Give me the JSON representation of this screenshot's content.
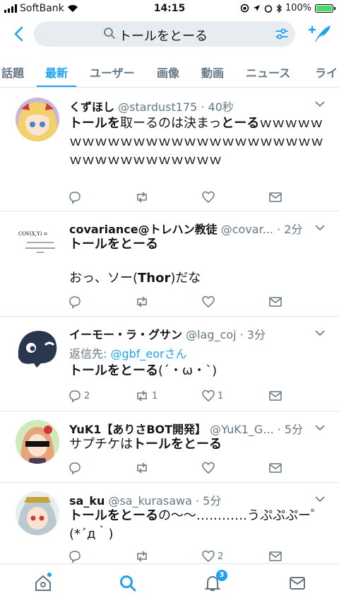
{
  "status": {
    "carrier": "SoftBank",
    "time": "14:15",
    "battery": "100%"
  },
  "search": {
    "query": "トールをとーる"
  },
  "tabs": [
    "話題",
    "最新",
    "ユーザー",
    "画像",
    "動画",
    "ニュース",
    "ライ"
  ],
  "tweets": [
    {
      "name": "くずほし",
      "meta": "@stardust175 · 40秒",
      "body_bold1": "トールを",
      "body_plain1": "取ーるのは決まっ",
      "body_bold2": "とーる",
      "body_plain2": "ｗｗｗｗｗｗｗｗｗｗｗｗｗｗｗｗｗｗｗｗｗｗｗｗｗｗｗｗｗｗｗｗｗｗｗｗｗ",
      "reply": "",
      "retweet": "",
      "like": ""
    },
    {
      "name": "covariance@トレハン教徒",
      "meta": "@covar... · 2分",
      "avatar_formula": "COV(X,Y) =",
      "body_bold1": "トールをとーる",
      "body_plain1": "おっ、ソー(",
      "body_bold2": "Thor",
      "body_plain2": ")だな",
      "reply": "",
      "retweet": "",
      "like": ""
    },
    {
      "name": "イーモー・ラ・グサン",
      "meta": "@lag_coj · 3分",
      "reply_label": "返信先: ",
      "reply_target": "@gbf_eorさん",
      "body_bold1": "トールをとーる",
      "body_plain1": "(´・ω・`)",
      "reply": "2",
      "retweet": "1",
      "like": "1"
    },
    {
      "name": "YuK1【ありさBOT開発】",
      "meta": "@YuK1_G... · 5分",
      "body_plain1": "サプチケは",
      "body_bold1": "トールをとーる",
      "reply": "",
      "retweet": "",
      "like": ""
    },
    {
      "name": "sa_ku",
      "meta": "@sa_kurasawa · 5分",
      "body_bold1": "トールをとーる",
      "body_plain1": "の〜〜…………うぷぷぷー゜(*´д｀)",
      "reply": "",
      "retweet": "",
      "like": "2"
    }
  ],
  "nav": {
    "notifications_badge": "3"
  },
  "colors": {
    "accent": "#1da1f2",
    "muted": "#657786",
    "border": "#e1e8ed"
  }
}
